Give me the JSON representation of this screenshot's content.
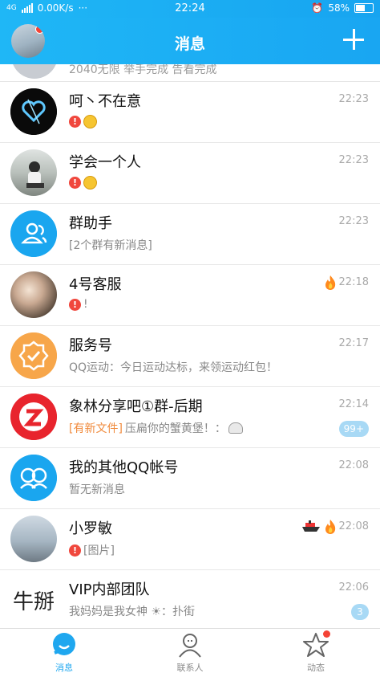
{
  "status_bar": {
    "network": "4G",
    "speed": "0.00K/s",
    "dots": "···",
    "time": "22:24",
    "battery": "58%"
  },
  "header": {
    "title": "消息",
    "plus_icon": "plus-icon"
  },
  "peek_row": {
    "message": "2040无限 举手完成 告看完成"
  },
  "conversations": [
    {
      "name": "呵丶不在意",
      "message": "",
      "time": "22:23",
      "has_error": true,
      "has_emoji": true,
      "avatar_color": "#111111"
    },
    {
      "name": "学会一个人",
      "message": "",
      "time": "22:23",
      "has_error": true,
      "has_emoji": true,
      "avatar_color": "#9ba6a0"
    },
    {
      "name": "群助手",
      "message": "[2个群有新消息]",
      "time": "22:23",
      "has_error": false,
      "has_emoji": false,
      "avatar_color": "#1aa6ef"
    },
    {
      "name": "4号客服",
      "message": "!",
      "time": "22:18",
      "has_error": true,
      "has_emoji": false,
      "avatar_color": "#6d6155"
    },
    {
      "name": "服务号",
      "message": "QQ运动：今日运动达标，来领运动红包！",
      "time": "22:17",
      "has_error": false,
      "has_emoji": false,
      "avatar_color": "#f7a64a"
    },
    {
      "name": "象林分享吧①群-后期",
      "message_tag": "[有新文件]",
      "message": "压扁你的蟹黄堡！：",
      "time": "22:14",
      "badge": "99+",
      "avatar_color": "#e8242d"
    },
    {
      "name": "我的其他QQ帐号",
      "message": "暂无新消息",
      "time": "22:08",
      "has_error": false,
      "has_emoji": false,
      "avatar_color": "#1aa6ef"
    },
    {
      "name": "小罗敏",
      "message": "[图片]",
      "time": "22:08",
      "has_error": true,
      "has_emoji": false,
      "avatar_color": "#8fa5b3"
    },
    {
      "name": "VIP内部团队",
      "message": "我妈妈是我女神 ☀：扑街",
      "time": "22:06",
      "badge": "3",
      "avatar_text": "牛掰"
    }
  ],
  "tabs": [
    {
      "label": "消息",
      "icon": "message-icon",
      "active": true
    },
    {
      "label": "联系人",
      "icon": "contacts-icon",
      "active": false
    },
    {
      "label": "动态",
      "icon": "star-icon",
      "active": false
    }
  ],
  "colors": {
    "accent": "#1fa7ef",
    "error": "#f0473d",
    "tag": "#f08a3c"
  }
}
